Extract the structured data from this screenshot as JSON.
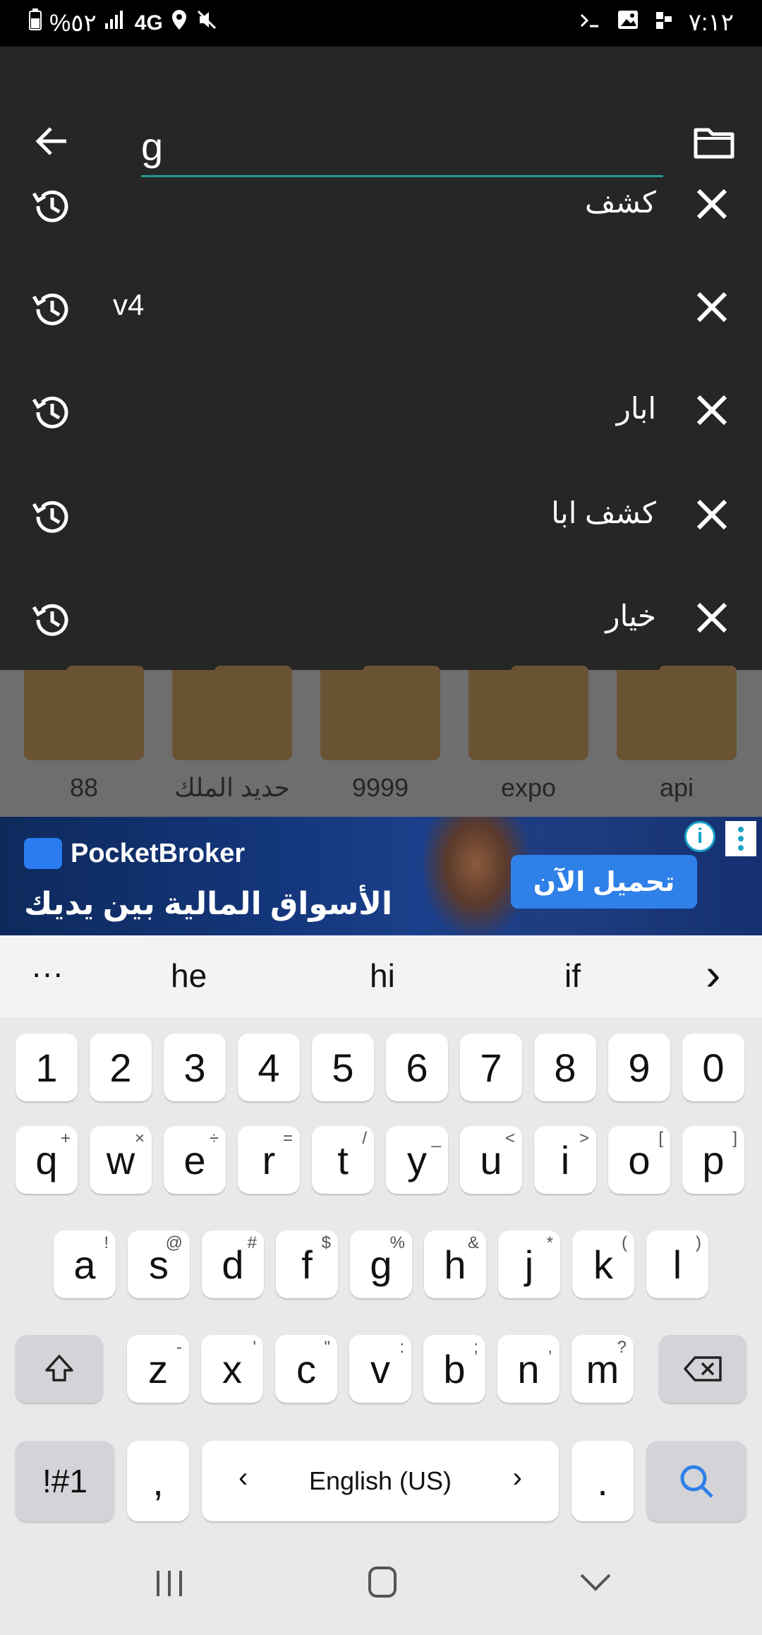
{
  "status_bar": {
    "battery": "%٥٢",
    "network": "4G",
    "time": "٧:١٢"
  },
  "search": {
    "query": "g"
  },
  "history": [
    {
      "text": "كشف"
    },
    {
      "text": "v4"
    },
    {
      "text": "ابار"
    },
    {
      "text": "كشف ابا"
    },
    {
      "text": "خيار"
    }
  ],
  "folders": [
    "88",
    "حديد الملك",
    "9999",
    "expo",
    "api"
  ],
  "ad": {
    "brand": "PocketBroker",
    "headline": "الأسواق المالية بين يديك",
    "cta": "تحميل الآن",
    "info": "i"
  },
  "suggestions": {
    "more": "···",
    "items": [
      "he",
      "hi",
      "if"
    ],
    "next": "›"
  },
  "keyboard": {
    "numbers": [
      "1",
      "2",
      "3",
      "4",
      "5",
      "6",
      "7",
      "8",
      "9",
      "0"
    ],
    "row1": [
      {
        "key": "q",
        "hint": "+"
      },
      {
        "key": "w",
        "hint": "×"
      },
      {
        "key": "e",
        "hint": "÷"
      },
      {
        "key": "r",
        "hint": "="
      },
      {
        "key": "t",
        "hint": "/"
      },
      {
        "key": "y",
        "hint": "_"
      },
      {
        "key": "u",
        "hint": "<"
      },
      {
        "key": "i",
        "hint": ">"
      },
      {
        "key": "o",
        "hint": "["
      },
      {
        "key": "p",
        "hint": "]"
      }
    ],
    "row2": [
      {
        "key": "a",
        "hint": "!"
      },
      {
        "key": "s",
        "hint": "@"
      },
      {
        "key": "d",
        "hint": "#"
      },
      {
        "key": "f",
        "hint": "$"
      },
      {
        "key": "g",
        "hint": "%"
      },
      {
        "key": "h",
        "hint": "&"
      },
      {
        "key": "j",
        "hint": "*"
      },
      {
        "key": "k",
        "hint": "("
      },
      {
        "key": "l",
        "hint": ")"
      }
    ],
    "row3": [
      {
        "key": "z",
        "hint": "-"
      },
      {
        "key": "x",
        "hint": "'"
      },
      {
        "key": "c",
        "hint": "\""
      },
      {
        "key": "v",
        "hint": ":"
      },
      {
        "key": "b",
        "hint": ";"
      },
      {
        "key": "n",
        "hint": ","
      },
      {
        "key": "m",
        "hint": "?"
      }
    ],
    "symbols_label": "!#1",
    "comma": ",",
    "space_label": "English (US)",
    "period": "."
  },
  "colors": {
    "accent": "#1f9c8c",
    "panel": "#262626",
    "search_key": "#2f80e8"
  }
}
